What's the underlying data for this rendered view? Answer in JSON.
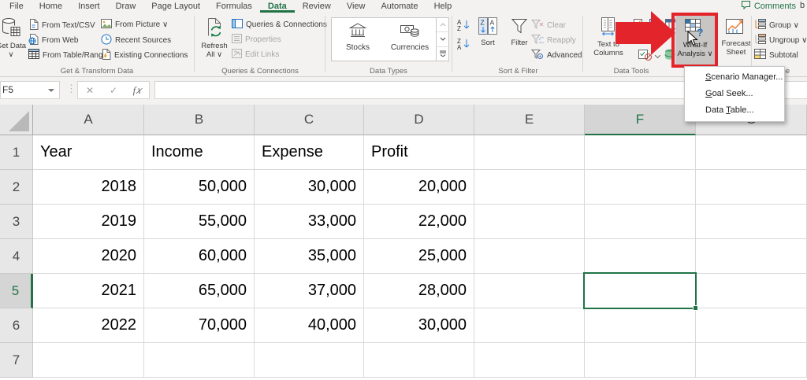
{
  "menu": {
    "tabs": [
      "File",
      "Home",
      "Insert",
      "Draw",
      "Page Layout",
      "Formulas",
      "Data",
      "Review",
      "View",
      "Automate",
      "Help"
    ],
    "active_tab": "Data"
  },
  "titlebar": {
    "comments": "Comments",
    "share_fragment": "b"
  },
  "ribbon": {
    "get_transform": {
      "get_data": "Get Data ∨",
      "items": [
        "From Text/CSV",
        "From Web",
        "From Table/Range",
        "From Picture ∨",
        "Recent Sources",
        "Existing Connections"
      ],
      "label": "Get & Transform Data"
    },
    "queries": {
      "refresh_all": "Refresh All ∨",
      "items": [
        "Queries & Connections",
        "Properties",
        "Edit Links"
      ],
      "label": "Queries & Connections"
    },
    "data_types": {
      "items": [
        "Stocks",
        "Currencies"
      ],
      "label": "Data Types"
    },
    "sort_filter": {
      "sort": "Sort",
      "filter": "Filter",
      "items": [
        "Clear",
        "Reapply",
        "Advanced"
      ],
      "label": "Sort & Filter"
    },
    "data_tools": {
      "text_to_columns": "Text to Columns",
      "label": "Data Tools"
    },
    "forecast": {
      "what_if": "What-If Analysis ∨",
      "forecast_sheet": "Forecast Sheet"
    },
    "outline": {
      "items": [
        "Group ∨",
        "Ungroup ∨",
        "Subtotal"
      ],
      "label": "Outline"
    }
  },
  "formula_bar": {
    "name_box": "F5",
    "formula": ""
  },
  "whatif_menu": {
    "items": [
      {
        "pre": "",
        "u": "S",
        "rest": "cenario Manager...",
        "label": "Scenario Manager..."
      },
      {
        "pre": "",
        "u": "G",
        "rest": "oal Seek...",
        "label": "Goal Seek..."
      },
      {
        "pre": "Data ",
        "u": "T",
        "rest": "able...",
        "label": "Data Table..."
      }
    ]
  },
  "sheet": {
    "columns": [
      "A",
      "B",
      "C",
      "D",
      "E",
      "F",
      "G"
    ],
    "selected_cell": "F5",
    "selected_column": "F",
    "selected_row": 5,
    "rows": [
      [
        "Year",
        "Income",
        "Expense",
        "Profit",
        "",
        "",
        ""
      ],
      [
        "2018",
        "50,000",
        "30,000",
        "20,000",
        "",
        "",
        ""
      ],
      [
        "2019",
        "55,000",
        "33,000",
        "22,000",
        "",
        "",
        ""
      ],
      [
        "2020",
        "60,000",
        "35,000",
        "25,000",
        "",
        "",
        ""
      ],
      [
        "2021",
        "65,000",
        "37,000",
        "28,000",
        "",
        "",
        ""
      ],
      [
        "2022",
        "70,000",
        "40,000",
        "30,000",
        "",
        "",
        ""
      ],
      [
        "",
        "",
        "",
        "",
        "",
        "",
        ""
      ]
    ]
  },
  "colors": {
    "excel_green": "#217346",
    "annotation_red": "#e3242b"
  }
}
